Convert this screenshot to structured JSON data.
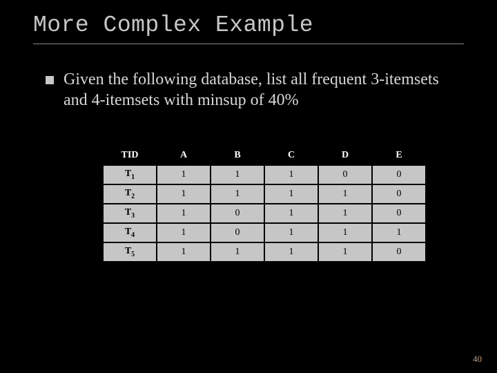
{
  "title": "More Complex Example",
  "bullet": "Given the following database, list all frequent 3-itemsets and 4-itemsets with minsup of 40%",
  "table": {
    "headers": [
      "TID",
      "A",
      "B",
      "C",
      "D",
      "E"
    ],
    "rows": [
      {
        "tid_base": "T",
        "tid_sub": "1",
        "cells": [
          "1",
          "1",
          "1",
          "0",
          "0"
        ]
      },
      {
        "tid_base": "T",
        "tid_sub": "2",
        "cells": [
          "1",
          "1",
          "1",
          "1",
          "0"
        ]
      },
      {
        "tid_base": "T",
        "tid_sub": "3",
        "cells": [
          "1",
          "0",
          "1",
          "1",
          "0"
        ]
      },
      {
        "tid_base": "T",
        "tid_sub": "4",
        "cells": [
          "1",
          "0",
          "1",
          "1",
          "1"
        ]
      },
      {
        "tid_base": "T",
        "tid_sub": "5",
        "cells": [
          "1",
          "1",
          "1",
          "1",
          "0"
        ]
      }
    ]
  },
  "page_number": "40"
}
